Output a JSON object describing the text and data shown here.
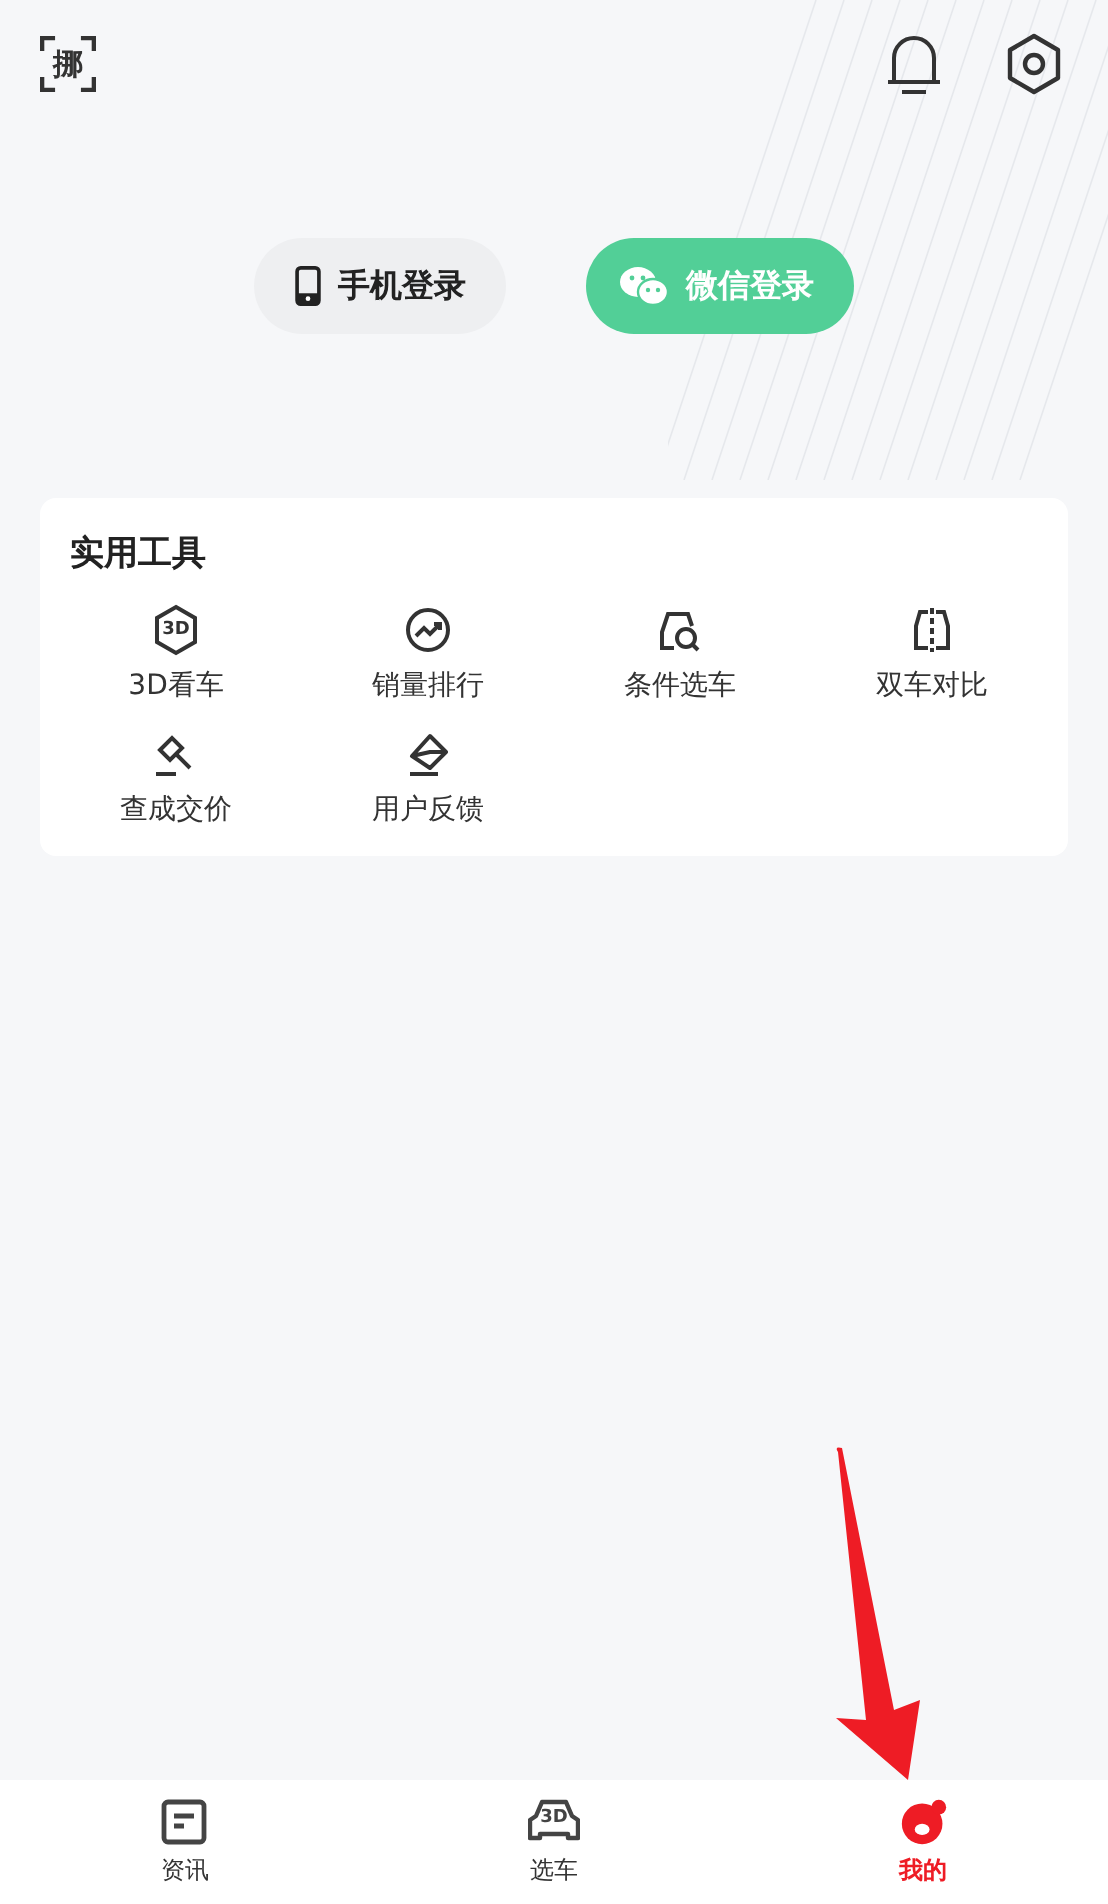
{
  "header": {
    "scan_glyph": "挪"
  },
  "login_buttons": [
    {
      "kind": "phone",
      "label": "手机登录"
    },
    {
      "kind": "wechat",
      "label": "微信登录"
    }
  ],
  "tools": {
    "title": "实用工具",
    "items": [
      {
        "kind": "threed",
        "label": "3D看车",
        "icon_text": "3D"
      },
      {
        "kind": "trend",
        "label": "销量排行"
      },
      {
        "kind": "searchcar",
        "label": "条件选车"
      },
      {
        "kind": "compare",
        "label": "双车对比"
      },
      {
        "kind": "hammer",
        "label": "查成交价"
      },
      {
        "kind": "feedback",
        "label": "用户反馈"
      }
    ]
  },
  "tabs": [
    {
      "kind": "news",
      "label": "资讯",
      "selected": false
    },
    {
      "kind": "car",
      "label": "选车",
      "selected": false,
      "icon_text": "3D"
    },
    {
      "kind": "me",
      "label": "我的",
      "selected": true
    }
  ]
}
